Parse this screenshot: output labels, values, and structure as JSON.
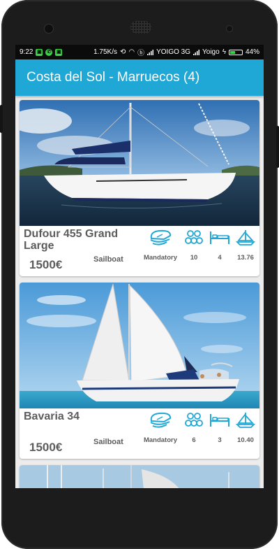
{
  "status_bar": {
    "time": "9:22",
    "speed": "1.75K/s",
    "carrier1": "YOIGO 3G",
    "carrier2": "Yoigo",
    "battery": "44%",
    "battery_level": 0.44
  },
  "app_bar": {
    "title": "Costa del Sol - Marruecos (4)"
  },
  "listings": [
    {
      "name": "Dufour 455 Grand Large",
      "price": "1500€",
      "type": "Sailboat",
      "skipper": "Mandatory",
      "guests": "10",
      "berths": "4",
      "length": "13.76"
    },
    {
      "name": "Bavaria 34",
      "price": "1500€",
      "type": "Sailboat",
      "skipper": "Mandatory",
      "guests": "6",
      "berths": "3",
      "length": "10.40"
    }
  ],
  "colors": {
    "accent": "#1fa7d6",
    "text": "#5c5c5c",
    "icon": "#1fa7d6"
  },
  "icons": [
    "captain-hat-icon",
    "people-icon",
    "bed-icon",
    "sailboat-icon"
  ]
}
